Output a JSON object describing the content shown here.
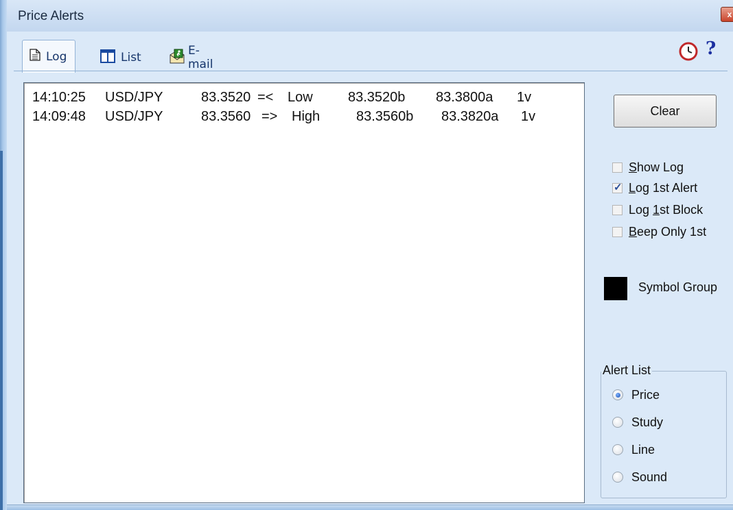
{
  "window": {
    "title": "Price Alerts",
    "close_glyph": "x"
  },
  "tabs": [
    {
      "label": "Log",
      "icon": "document-icon",
      "active": true
    },
    {
      "label": "List",
      "icon": "columns-icon",
      "active": false
    },
    {
      "label": "E-mail",
      "icon": "email-runner-icon",
      "active": false
    }
  ],
  "toolbar_icons": {
    "clock": "clock-icon",
    "help": "?"
  },
  "log": {
    "lines": [
      {
        "time": "14:10:25",
        "symbol": "USD/JPY",
        "price": "83.3520",
        "dir": "=<",
        "level": "Low",
        "bid": "83.3520b",
        "ask": "83.3800a",
        "vol": "1v"
      },
      {
        "time": "14:09:48",
        "symbol": "USD/JPY",
        "price": "83.3560",
        "dir": "=>",
        "level": "High",
        "bid": "83.3560b",
        "ask": "83.3820a",
        "vol": "1v"
      }
    ]
  },
  "controls": {
    "clear_label": "Clear",
    "checkboxes": [
      {
        "pre": "",
        "ul": "S",
        "post": "how Log",
        "checked": false
      },
      {
        "pre": "",
        "ul": "L",
        "post": "og 1st Alert",
        "checked": true
      },
      {
        "pre": "Log ",
        "ul": "1",
        "post": "st Block",
        "checked": false
      },
      {
        "pre": "",
        "ul": "B",
        "post": "eep Only 1st",
        "checked": false
      }
    ],
    "symbol_group": {
      "label": "Symbol Group",
      "color": "#000000"
    },
    "alert_list": {
      "legend": "Alert List",
      "options": [
        "Price",
        "Study",
        "Line",
        "Sound"
      ],
      "selected": "Price"
    }
  },
  "colors": {
    "client_bg": "#dbe9f8",
    "tab_text": "#16356b",
    "help": "#1b2fa0",
    "clock": "#c0282a"
  }
}
